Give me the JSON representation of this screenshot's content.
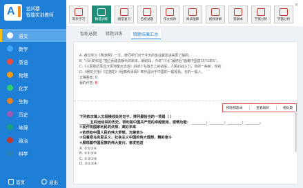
{
  "brand": {
    "logo_text": "A",
    "line1": "追问楼",
    "line2": "智能实训教师"
  },
  "sidebar": {
    "items": [
      {
        "label": "语文",
        "color": "#ffffff",
        "active": true
      },
      {
        "label": "数学",
        "color": "#3fa9f5"
      },
      {
        "label": "英语",
        "color": "#e74c3c"
      },
      {
        "label": "物理",
        "color": "#f39c12"
      },
      {
        "label": "化学",
        "color": "#2ecc71"
      },
      {
        "label": "生物",
        "color": "#e67e22"
      },
      {
        "label": "历史",
        "color": "#9b59b6"
      },
      {
        "label": "地理",
        "color": "#16a085"
      },
      {
        "label": "政治",
        "color": "#c0392b"
      },
      {
        "label": "科学",
        "color": "#2980b9"
      }
    ],
    "footer": {
      "home": "首页",
      "exit": "退出"
    }
  },
  "toolbar": {
    "tools": [
      "同步学习",
      "精选训练",
      "随堂复习",
      "名校试题",
      "作文批改",
      "阅读理解",
      "视频讲解",
      "错题本",
      "学情分析",
      "学霸分析"
    ],
    "active_index": 1,
    "close": "×"
  },
  "tabs": [
    "智能选题",
    "错题训练",
    "错题结果汇总"
  ],
  "active_tab": 2,
  "question1": {
    "lines": [
      "A. 通过学习《陶渊明》一文，使同学们对于今天的象征越发进来更了解的。",
      "B. “闪闪的红星”独立而建造朝代的新本，朝前段，今年“川北”最终后”面撤中国直1572年5”。",
      "C.《入民航抗军应大军地瓣水流泡》讲述了在敌方上的战役，人民的战斗力，你的一些新，你的",
      "D.《朝花夕拾》《拉骆驼》《经典传承阅》等作品对于中国的一般观看，也的一般人。"
    ],
    "answer_label": "正确答案:",
    "answer_value": "D",
    "my_answer_label": "我的作答:",
    "my_answer_value": "B"
  },
  "actions": [
    "移除错题本",
    "查看解析",
    "相似题"
  ],
  "question2": {
    "stem": "下列依次填入文段横线处的句子，排列最恰当的一项是（    ）",
    "intro_prefix": "______五四运动来的历史，很利是中国共产党的卓越使用，感慨功能：",
    "blanks": "________；________；________；________。",
    "items": [
      "①民作将国家利民的法规，美好未来",
      "②依然有中国人民的伟大梦想，光荣奋斗",
      "③沿着把马克思主义，社会主义中国的伟大理想，精彩奋斗",
      "④展现着中国民族的伟大复兴，奋发拓进"
    ],
    "options": [
      "A. ①②③④",
      "B. ②①③④",
      "C. ①③②④",
      "D. ③①②④"
    ]
  }
}
